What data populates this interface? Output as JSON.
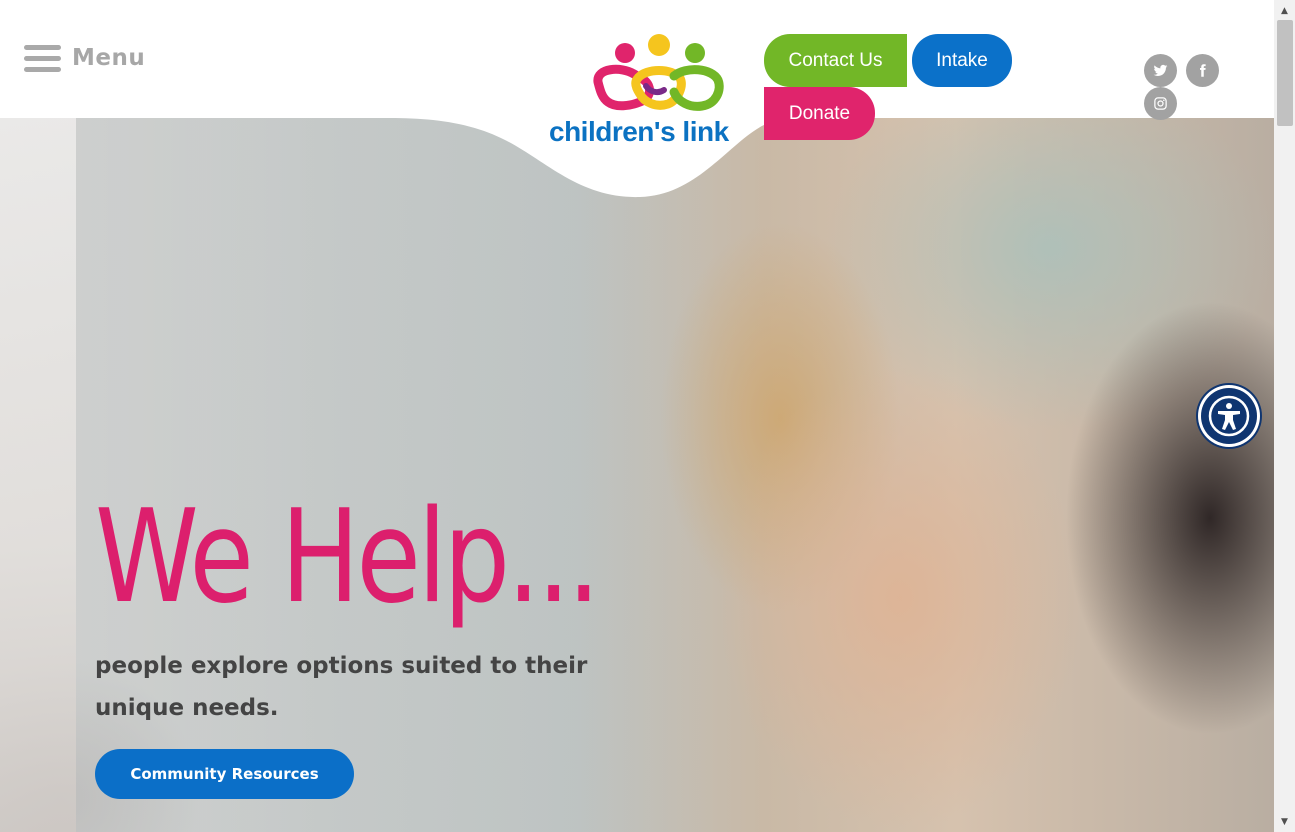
{
  "header": {
    "menu_label": "Menu",
    "logo_text": "children's link",
    "buttons": {
      "contact": "Contact Us",
      "intake": "Intake",
      "donate": "Donate"
    },
    "social": [
      "twitter-icon",
      "facebook-icon",
      "instagram-icon"
    ]
  },
  "hero": {
    "title": "We Help...",
    "subtitle": "people explore options suited to their unique needs.",
    "cta_label": "Community Resources"
  },
  "colors": {
    "brand_blue": "#0b71c9",
    "brand_green": "#72b727",
    "brand_pink": "#e0246c",
    "brand_yellow": "#f5c51e",
    "accessibility_navy": "#0f3570"
  }
}
